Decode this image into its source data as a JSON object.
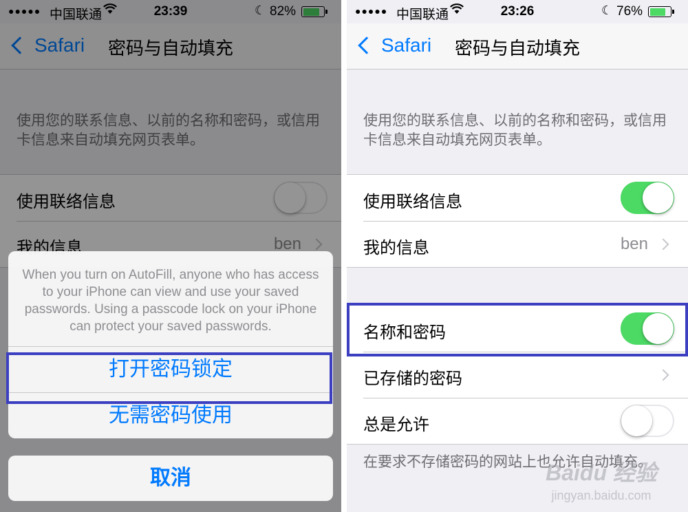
{
  "left": {
    "status": {
      "signal": "●●●●●",
      "carrier": "中国联通",
      "time": "23:39",
      "battery_pct": "82%",
      "battery_level": 0.82
    },
    "nav": {
      "back": "Safari",
      "title": "密码与自动填充"
    },
    "description": "使用您的联系信息、以前的名称和密码，或信用卡信息来自动填充网页表单。",
    "rows": [
      {
        "label": "使用联络信息",
        "switch_on": false
      },
      {
        "label": "我的信息",
        "detail": "ben"
      }
    ],
    "sheet": {
      "message": "When you turn on AutoFill, anyone who has access to your iPhone can view and use your saved passwords. Using a passcode lock on your iPhone can protect your saved passwords.",
      "primary_button": "打开密码锁定",
      "secondary_button": "无需密码使用",
      "cancel_button": "取消"
    }
  },
  "right": {
    "status": {
      "signal": "●●●●●",
      "carrier": "中国联通",
      "time": "23:26",
      "battery_pct": "76%",
      "battery_level": 0.76
    },
    "nav": {
      "back": "Safari",
      "title": "密码与自动填充"
    },
    "description": "使用您的联系信息、以前的名称和密码，或信用卡信息来自动填充网页表单。",
    "group1": [
      {
        "label": "使用联络信息",
        "switch_on": true
      },
      {
        "label": "我的信息",
        "detail": "ben"
      }
    ],
    "group2": [
      {
        "label": "名称和密码",
        "switch_on": true
      },
      {
        "label": "已存储的密码"
      },
      {
        "label": "总是允许",
        "switch_on": false
      }
    ],
    "footer": "在要求不存储密码的网站上也允许自动填充。"
  },
  "watermark": {
    "brand": "Baidu 经验",
    "site": "jingyan.baidu.com"
  },
  "colors": {
    "accent": "#007aff",
    "switch_on": "#4cd964",
    "highlight": "#3b3fc0",
    "background": "#efeff4"
  }
}
